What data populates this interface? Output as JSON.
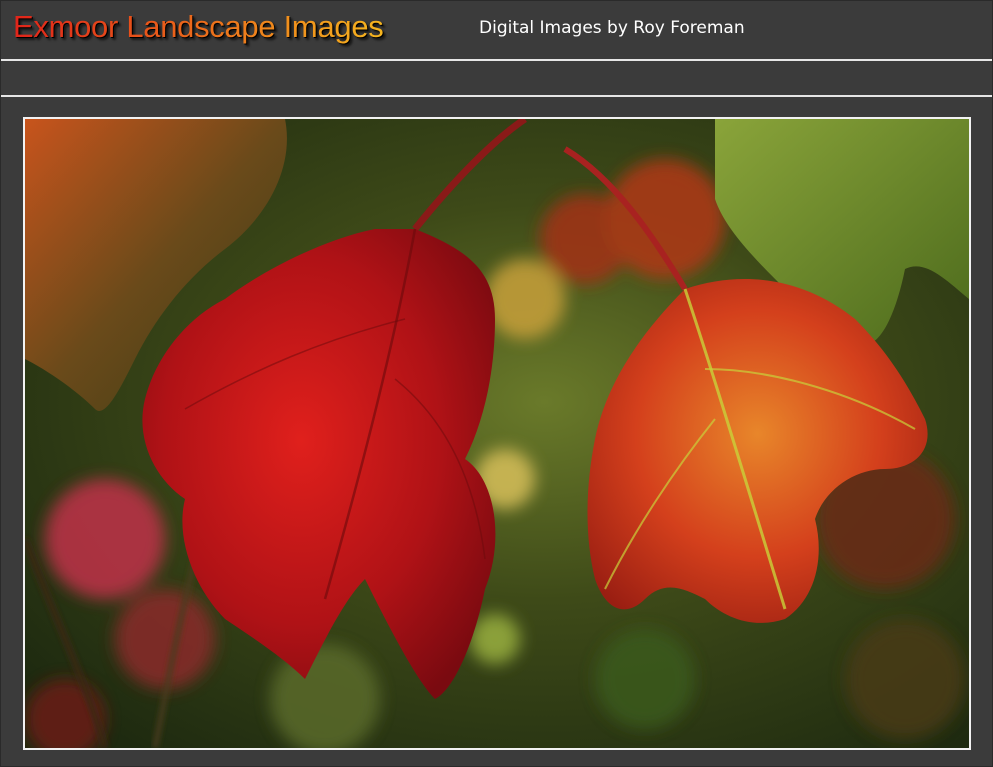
{
  "header": {
    "title": "Exmoor Landscape Images",
    "subtitle": "Digital Images by Roy Foreman"
  },
  "colors": {
    "background": "#3b3b3b",
    "rule": "#e6e6e6",
    "title_gradient_start": "#e0241a",
    "title_gradient_end": "#f5b51f",
    "subtitle": "#ffffff",
    "frame_border": "#f2f2f2"
  },
  "main": {
    "photo": {
      "subject": "autumn oak-leaf hydrangea leaves"
    }
  }
}
